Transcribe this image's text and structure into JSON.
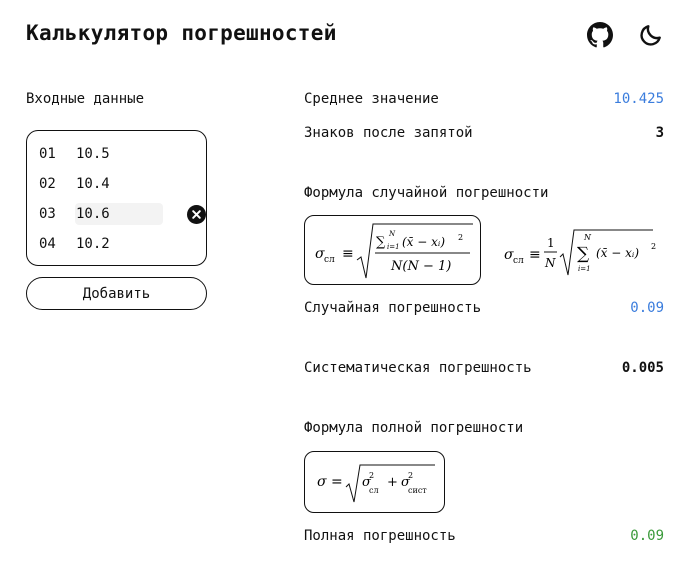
{
  "app": {
    "title": "Калькулятор погрешностей"
  },
  "icons": {
    "github": "github-icon",
    "theme": "moon-icon"
  },
  "inputs": {
    "label": "Входные данные",
    "rows": [
      {
        "index": "01",
        "value": "10.5"
      },
      {
        "index": "02",
        "value": "10.4"
      },
      {
        "index": "03",
        "value": "10.6"
      },
      {
        "index": "04",
        "value": "10.2"
      }
    ],
    "add_label": "Добавить"
  },
  "results": {
    "mean_label": "Среднее значение",
    "mean_value": "10.425",
    "decimals_label": "Знаков после запятой",
    "decimals_value": "3",
    "random_formula_label": "Формула случайной погрешности",
    "random_error_label": "Случайная погрешность",
    "random_error_value": "0.09",
    "systematic_label": "Систематическая погрешность",
    "systematic_value": "0.005",
    "full_formula_label": "Формула полной погрешности",
    "full_error_label": "Полная погрешность",
    "full_error_value": "0.09"
  },
  "formulas": {
    "sigma": "σ",
    "sub_random": "сл",
    "sub_system": "сист",
    "equiv": "≡",
    "equals": "=",
    "sum": "∑",
    "upper": "N",
    "lower": "i=1",
    "term": "(x̄ − xᵢ)",
    "power": "2",
    "denominator": "N(N − 1)",
    "one": "1",
    "n": "N",
    "plus": "+"
  },
  "colors": {
    "accent_blue": "#3b7ddd",
    "accent_green": "#3a9a3a",
    "text": "#111111"
  }
}
